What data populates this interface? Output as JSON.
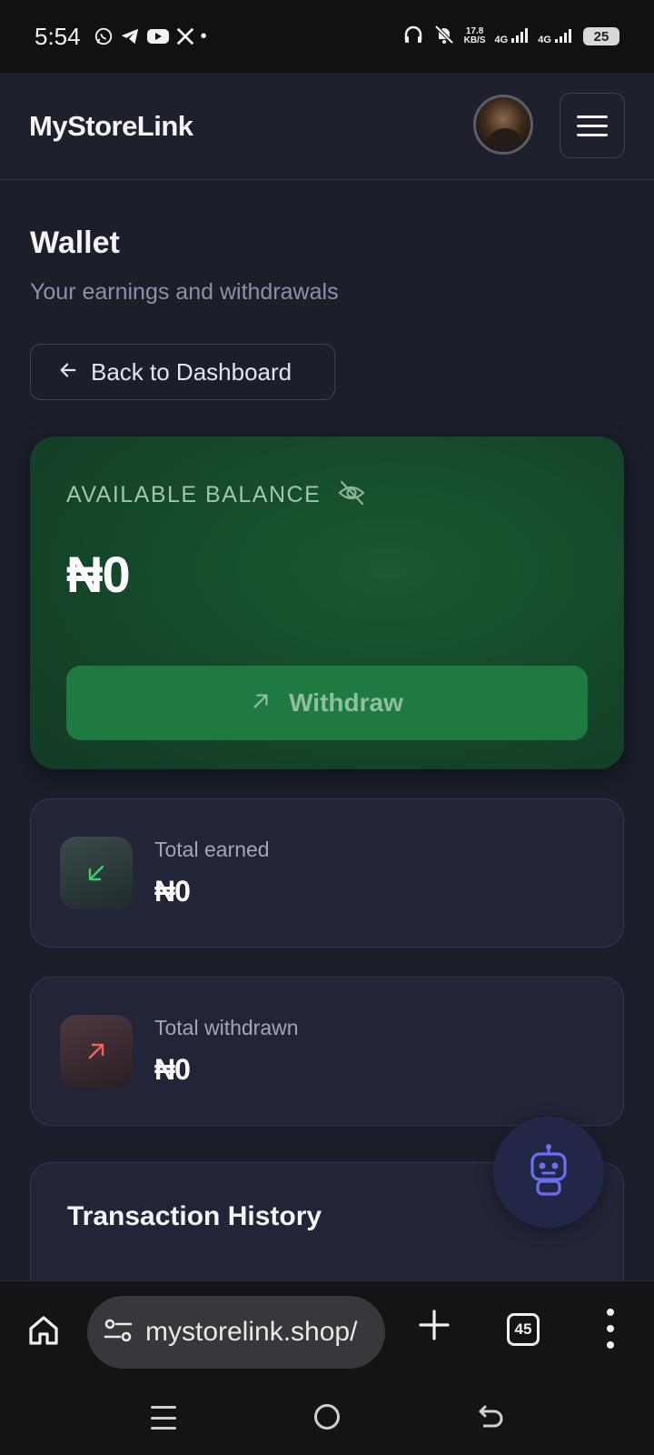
{
  "status_bar": {
    "time": "5:54",
    "speed_value": "17.8",
    "speed_unit": "KB/S",
    "net1": "4G",
    "net2": "4G",
    "battery": "25"
  },
  "header": {
    "logo": "MyStoreLink"
  },
  "page": {
    "title": "Wallet",
    "subtitle": "Your earnings and withdrawals",
    "back_label": "Back to Dashboard"
  },
  "balance": {
    "label": "AVAILABLE BALANCE",
    "amount": "₦0",
    "withdraw_label": "Withdraw"
  },
  "stats": [
    {
      "label": "Total earned",
      "value": "₦0"
    },
    {
      "label": "Total withdrawn",
      "value": "₦0"
    }
  ],
  "transactions": {
    "title": "Transaction History"
  },
  "browser": {
    "url": "mystorelink.shop/",
    "tab_count": "45"
  },
  "colors": {
    "accent_green": "#1f7a42",
    "earned_green": "#3ecf6c",
    "withdrawn_red": "#f0655c",
    "bot_purple": "#6b6ef0"
  },
  "icons": [
    "whatsapp-icon",
    "telegram-icon",
    "youtube-icon",
    "x-icon",
    "headphones-icon",
    "bell-off-icon",
    "eye-off-icon",
    "arrow-left-icon",
    "arrow-up-right-icon",
    "arrow-down-left-icon",
    "robot-icon",
    "home-icon",
    "site-settings-icon",
    "plus-icon",
    "more-icon"
  ]
}
